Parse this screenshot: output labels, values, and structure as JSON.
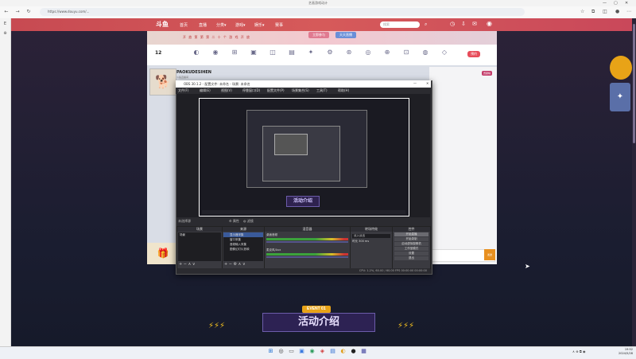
{
  "browser": {
    "window_title": "艺画游戏动计",
    "url": "https://www.douyu.com/...",
    "sidebar_glyphs": [
      "E",
      "⊕"
    ]
  },
  "site": {
    "logo": "斗鱼",
    "nav": [
      "首页",
      "直播",
      "分类▾",
      "游戏▾",
      "娱乐▾",
      "赛事"
    ],
    "search_placeholder": "搜索",
    "banner_text": "开 放 第 第 第 二 十 个 游 戏 开 放",
    "banner_btn_1": "立即参与",
    "banner_btn_2": "天天直播",
    "room_number": "12",
    "room_icons": [
      {
        "glyph": "◐",
        "label": ""
      },
      {
        "glyph": "◉",
        "label": ""
      },
      {
        "glyph": "⊞",
        "label": ""
      },
      {
        "glyph": "▣",
        "label": ""
      },
      {
        "glyph": "◫",
        "label": ""
      },
      {
        "glyph": "▤",
        "label": ""
      },
      {
        "glyph": "✦",
        "label": ""
      },
      {
        "glyph": "⚙",
        "label": ""
      },
      {
        "glyph": "⊛",
        "label": ""
      },
      {
        "glyph": "◎",
        "label": ""
      },
      {
        "glyph": "⊕",
        "label": ""
      },
      {
        "glyph": "⊡",
        "label": ""
      },
      {
        "glyph": "◍",
        "label": ""
      },
      {
        "glyph": "◇",
        "label": ""
      }
    ],
    "room_btn": "预约",
    "anchor_name": "PAOKUDESIHEN",
    "anchor_sub": "斗鱼直播间",
    "right_panel_items": [
      {
        "label": "",
        "badge": "贡献榜"
      },
      {
        "label": "",
        "badge": ""
      },
      {
        "label": "",
        "badge": ""
      },
      {
        "label": "",
        "badge": ""
      },
      {
        "label": "",
        "badge": ""
      },
      {
        "label": "",
        "badge": ""
      }
    ],
    "right_panel_text": "",
    "chat_placeholder": "",
    "chat_send": "发送",
    "event_tag": "EVENT 01",
    "event_title": "活动介绍",
    "side_promo": "",
    "colors": {
      "nav": "#d65a5a",
      "accent": "#e8a317"
    }
  },
  "obs": {
    "title": "OBS 30.1.2 - 配置文件: 未命名 - 场景: 未命名",
    "menu": [
      "文件(F)",
      "编辑(E)",
      "视图(V)",
      "停靠窗口(D)",
      "配置文件(P)",
      "场景集合(S)",
      "工具(T)",
      "帮助(H)"
    ],
    "preview_event": "活动介绍",
    "scene_label": "未选择源",
    "props_btn": "⚙ 属性",
    "filter_btn": "◍ 滤镜",
    "docks": {
      "scenes": {
        "title": "场景",
        "items": [
          "场景"
        ]
      },
      "sources": {
        "title": "来源",
        "items": [
          "显示器采集",
          "窗口采集",
          "音频输入采集",
          "图像幻灯片放映"
        ]
      },
      "mixer": {
        "title": "混音器",
        "channels": [
          "桌面音频",
          "麦克风/Aux"
        ]
      },
      "transitions": {
        "title": "转场特效",
        "type": "淡入淡出",
        "duration_label": "时长",
        "duration": "300 ms"
      },
      "controls": {
        "title": "控件",
        "buttons": [
          "开始直播",
          "开始录制",
          "启动虚拟摄像机",
          "工作室模式",
          "设置",
          "退出"
        ]
      }
    },
    "status": "CPU: 1.2%, 60.00 / 60.00 FPS   00:00:00   00:00:00"
  },
  "taskbar": {
    "apps": [
      {
        "glyph": "⊞",
        "color": "#1e6fd0"
      },
      {
        "glyph": "◎",
        "color": "#333"
      },
      {
        "glyph": "▭",
        "color": "#555"
      },
      {
        "glyph": "▣",
        "color": "#3a7ae0"
      },
      {
        "glyph": "◉",
        "color": "#2a9a5a"
      },
      {
        "glyph": "◈",
        "color": "#d03a3a"
      },
      {
        "glyph": "▤",
        "color": "#2a6ad0"
      },
      {
        "glyph": "◐",
        "color": "#e0a020"
      },
      {
        "glyph": "●",
        "color": "#222"
      },
      {
        "glyph": "▦",
        "color": "#3a3a9a"
      }
    ],
    "tray": "∧  ⊕  ⧉  ◉",
    "time": "19:52",
    "date": "2024/5/28"
  }
}
